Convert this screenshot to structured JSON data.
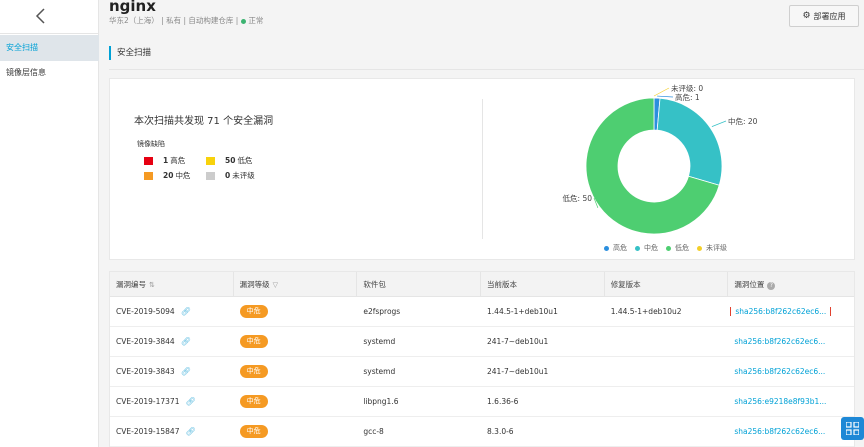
{
  "app": {
    "title": "nginx"
  },
  "meta": {
    "region": "华东2（上海）",
    "visibility": "私有",
    "source": "自动构建仓库",
    "status": "正常",
    "status_color": "#3cb371"
  },
  "header": {
    "deploy_label": "部署应用"
  },
  "sidebar": {
    "items": [
      {
        "label": "安全扫描"
      },
      {
        "label": "镜像层信息"
      }
    ]
  },
  "section": {
    "title": "安全扫描"
  },
  "summary": {
    "text": "本次扫描共发现 71 个安全漏洞",
    "legend_title": "镜像缺陷",
    "levels": [
      {
        "count": "1",
        "label": "高危",
        "color": "#e60012"
      },
      {
        "count": "50",
        "label": "低危",
        "color": "#f8d20c"
      },
      {
        "count": "20",
        "label": "中危",
        "color": "#f59a23"
      },
      {
        "count": "0",
        "label": "未评级",
        "color": "#cccccc"
      }
    ]
  },
  "chart_data": {
    "type": "pie",
    "categories": [
      "高危",
      "中危",
      "低危",
      "未评级"
    ],
    "values": [
      1,
      20,
      50,
      0
    ],
    "colors": [
      "#2b8fde",
      "#36c1c6",
      "#4ece71",
      "#f3cf29"
    ],
    "labels": [
      "高危: 1",
      "中危: 20",
      "低危: 50",
      "未评级: 0"
    ],
    "legend": "bottom"
  },
  "table": {
    "columns": [
      "漏洞编号",
      "漏洞等级",
      "软件包",
      "当前版本",
      "修复版本",
      "漏洞位置"
    ],
    "rows": [
      {
        "id": "CVE-2019-5094",
        "level": "中危",
        "package": "e2fsprogs",
        "current": "1.44.5-1+deb10u1",
        "fixed": "1.44.5-1+deb10u2",
        "location": "sha256:b8f262c62ec6..."
      },
      {
        "id": "CVE-2019-3844",
        "level": "中危",
        "package": "systemd",
        "current": "241-7~deb10u1",
        "fixed": "",
        "location": "sha256:b8f262c62ec6..."
      },
      {
        "id": "CVE-2019-3843",
        "level": "中危",
        "package": "systemd",
        "current": "241-7~deb10u1",
        "fixed": "",
        "location": "sha256:b8f262c62ec6..."
      },
      {
        "id": "CVE-2019-17371",
        "level": "中危",
        "package": "libpng1.6",
        "current": "1.6.36-6",
        "fixed": "",
        "location": "sha256:e9218e8f93b1..."
      },
      {
        "id": "CVE-2019-15847",
        "level": "中危",
        "package": "gcc-8",
        "current": "8.3.0-6",
        "fixed": "",
        "location": "sha256:b8f262c62ec6..."
      }
    ]
  }
}
